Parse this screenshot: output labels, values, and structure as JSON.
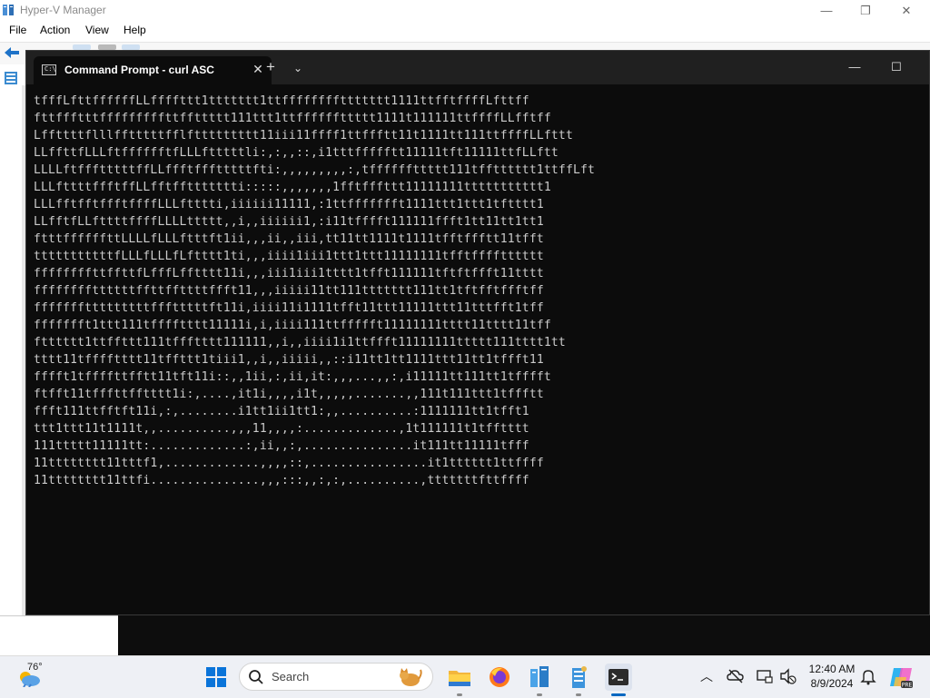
{
  "hyperv": {
    "title": "Hyper-V Manager",
    "menu": [
      "File",
      "Action",
      "View",
      "Help"
    ],
    "window_controls": {
      "minimize": "—",
      "maximize": "❐",
      "close": "✕"
    }
  },
  "terminal": {
    "tab_title": "Command Prompt - curl  ASC",
    "tab_close": "✕",
    "new_tab": "+",
    "dropdown": "⌄",
    "window_controls": {
      "minimize": "—",
      "maximize": "☐"
    },
    "output_lines": [
      "tfffLfttffffffLLffffttt1ttttttt1ttffffffffttttttt1111ttfftffffLfttff",
      "fttffftttfffffffffttffttttt111ttt1ttffffffttttt1111t111111ttffffLLfftff",
      "Lffttttflllfftttttfflfttttttttt11iii11ffff1ttffftt11t1111tt111ttffffLLfttt",
      "LLffttfLLLftfffffftfLLLftttttli:,:,,::,i1tttffffftt11111tft11111ttfLLftt",
      "LLLLftffftttttffLLffftffftttttfti:,,,,,,,,,:,tffffffttttt111tfftttttt1ttffLft",
      "LLLfttttffftffLLfftffttttttti:::::,,,,,,,1fftfffttt11111111ttttttttttt1",
      "LLLfftfftffftffffLLLftttti,iiiiii11111,:1ttffffffft1111ttt1ttt1tftttt1",
      "LLfftfLLfttttffffLLLLttttt,,i,,iiiiii1,:i11tfffft111111ffft1tt11tt1tt1",
      "ftttffffffttLLLLfLLLftttft1ii,,,ii,,iii,tt11tt1111t1111tfftffftt11tfft",
      "tttttttttttfLLLfLLLfLftttt1ti,,,iiii1iii1ttt1ttt11111111tfftfffftttttt",
      "ffffffffttffttfLfffLfftttt11i,,,iii1iii1tttt1tfft111111tftftffft11tttt",
      "ffffffffttttttffttffttttffft11,,,iiiii11tt111ttttttt111tt1tftfftffftff",
      "ffffffftttttttttffftttttft11i,iiii11i1111tfft11ttt11111ttt11tttfft1tff",
      "ffffffft1ttt111tfffftttt11111i,i,iiii111ttffffft11111111tttt11tttt11tff",
      "ftttttt1ttffttt111tffftttt111111,,i,,iiii1i1ttffft11111111ttttt111tttt1tt",
      "tttt11tfffftttt11tffttt1tiii1,,i,,iiiii,,::i11tt1tt1111ttt11tt1tffft11",
      "fffft1tffffttfftt11tft11i::,,1ii,:,ii,it:,,,...,,:,i11111tt111tt1tfffft",
      "ftfft11tfffttfftttt1i:,....,it1i,,,,i1t,,,,,.......,,111t111ttt1tffftt",
      "ffft111ttfftft11i,:,........i1tt1ii1tt1:,,..........:1111111tt1tfft1",
      "ttt1ttt11t1111t,,..........,,,11,,,,:.............,1t111111t1tfftttt",
      "111ttttt11111tt:.............:,ii,,:,...............it111tt11111tfff",
      "11tttttttt11tttf1,.............,,,,::,................it1tttttt1ttffff",
      "11tttttttt11ttfi...............,,,:::,,:,:,..........,tttttttfttffff"
    ]
  },
  "taskbar": {
    "weather_temp": "76°",
    "search_placeholder": "Search",
    "clock_time": "12:40 AM",
    "clock_date": "8/9/2024",
    "tray": {
      "chevron": "︿"
    }
  },
  "colors": {
    "terminal_bg": "#0c0c0c",
    "terminal_text": "#cccccc",
    "accent": "#0067c0"
  }
}
